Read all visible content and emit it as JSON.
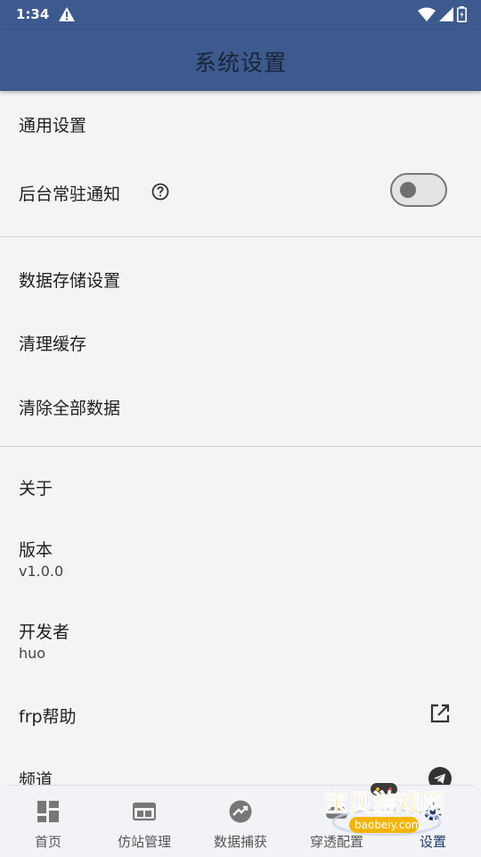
{
  "status_bar": {
    "time": "1:34"
  },
  "header": {
    "title": "系统设置"
  },
  "sections": {
    "general": {
      "title": "通用设置",
      "background_notify": {
        "label": "后台常驻通知",
        "enabled": false
      }
    },
    "storage": {
      "title": "数据存储设置",
      "clear_cache": "清理缓存",
      "clear_all": "清除全部数据"
    },
    "about": {
      "title": "关于",
      "version_label": "版本",
      "version_value": "v1.0.0",
      "developer_label": "开发者",
      "developer_value": "huo",
      "frp_help": "frp帮助",
      "channel": "频道"
    }
  },
  "bottom_nav": {
    "items": [
      {
        "label": "首页",
        "icon": "dashboard-icon"
      },
      {
        "label": "仿站管理",
        "icon": "web-icon"
      },
      {
        "label": "数据捕获",
        "icon": "trending-icon"
      },
      {
        "label": "穿透配置",
        "icon": "cloud-icon"
      },
      {
        "label": "设置",
        "icon": "settings-icon"
      }
    ],
    "active_index": 4
  },
  "watermark": {
    "text": "宝贝游戏网",
    "url_text": "baobeiy.com"
  },
  "colors": {
    "primary": "#3d5a8f",
    "background": "#f4f4f4",
    "nav_bg": "#f2f3f7"
  }
}
